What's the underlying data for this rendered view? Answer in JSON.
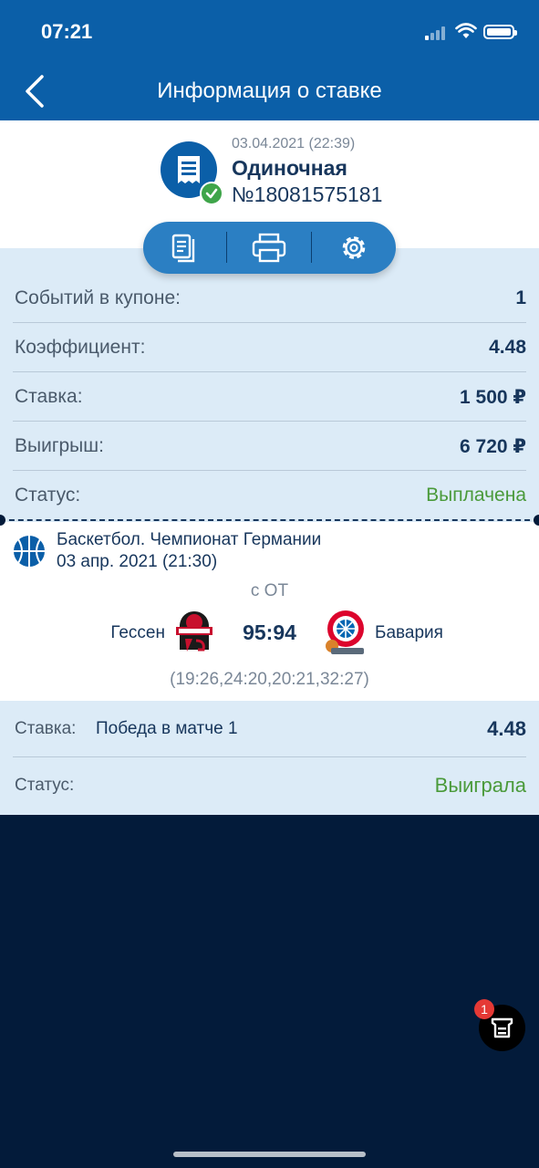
{
  "status_bar": {
    "time": "07:21"
  },
  "nav": {
    "title": "Информация о ставке",
    "back_icon": "chevron-left-icon"
  },
  "bet_summary": {
    "date": "03.04.2021 (22:39)",
    "type": "Одиночная",
    "number": "№18081575181",
    "status_icon": "check-icon"
  },
  "toolbar": {
    "items": [
      {
        "icon": "copy-coupon-icon"
      },
      {
        "icon": "print-icon"
      },
      {
        "icon": "gear-icon"
      }
    ]
  },
  "details": {
    "rows": [
      {
        "label": "Событий в купоне:",
        "value": "1"
      },
      {
        "label": "Коэффициент:",
        "value": "4.48"
      },
      {
        "label": "Ставка:",
        "value": "1 500 ₽"
      },
      {
        "label": "Выигрыш:",
        "value": "6 720 ₽"
      },
      {
        "label": "Статус:",
        "value": "Выплачена"
      }
    ]
  },
  "event": {
    "sport_icon": "basketball-icon",
    "league": "Баскетбол. Чемпионат Германии",
    "date": "03 апр. 2021 (21:30)",
    "note": "с ОТ",
    "home_team": "Гессен",
    "away_team": "Бавария",
    "score": "95:94",
    "periods": "(19:26,24:20,20:21,32:27)"
  },
  "bet": {
    "stake_label": "Ставка:",
    "outcome": "Победа в матче 1",
    "odds": "4.48",
    "status_label": "Статус:",
    "status_value": "Выиграла"
  },
  "fab": {
    "badge": "1",
    "icon": "coupon-icon"
  },
  "colors": {
    "brand": "#0b5fa8",
    "success": "#4a9a3a",
    "background": "#031b3a"
  }
}
